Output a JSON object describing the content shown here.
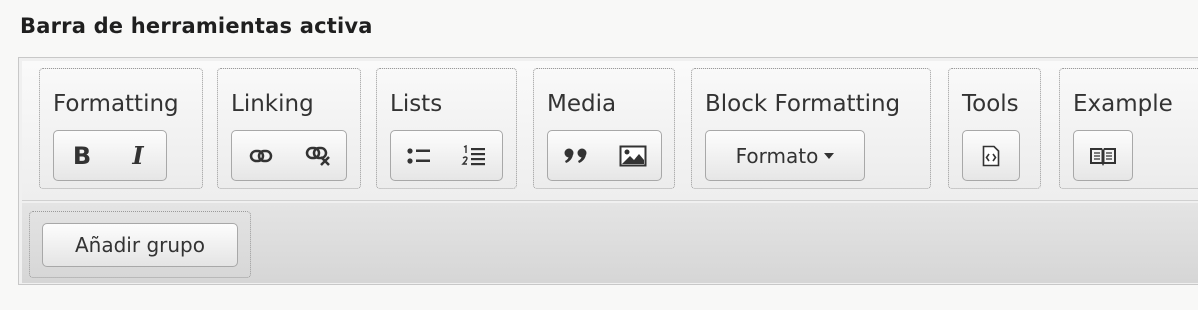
{
  "page": {
    "title": "Barra de herramientas activa"
  },
  "toolbar": {
    "groups": [
      {
        "label": "Formatting",
        "buttons": [
          "B",
          "I"
        ],
        "icons": [
          "bold-icon",
          "italic-icon"
        ]
      },
      {
        "label": "Linking",
        "icons": [
          "link-icon",
          "unlink-icon"
        ]
      },
      {
        "label": "Lists",
        "icons": [
          "bulleted-list-icon",
          "numbered-list-icon"
        ]
      },
      {
        "label": "Media",
        "icons": [
          "blockquote-icon",
          "image-icon"
        ]
      },
      {
        "label": "Block Formatting",
        "dropdown": "Formato"
      },
      {
        "label": "Tools",
        "icons": [
          "source-code-icon"
        ]
      },
      {
        "label": "Example",
        "icons": [
          "book-icon"
        ]
      }
    ],
    "add_group_label": "Añadir grupo"
  }
}
